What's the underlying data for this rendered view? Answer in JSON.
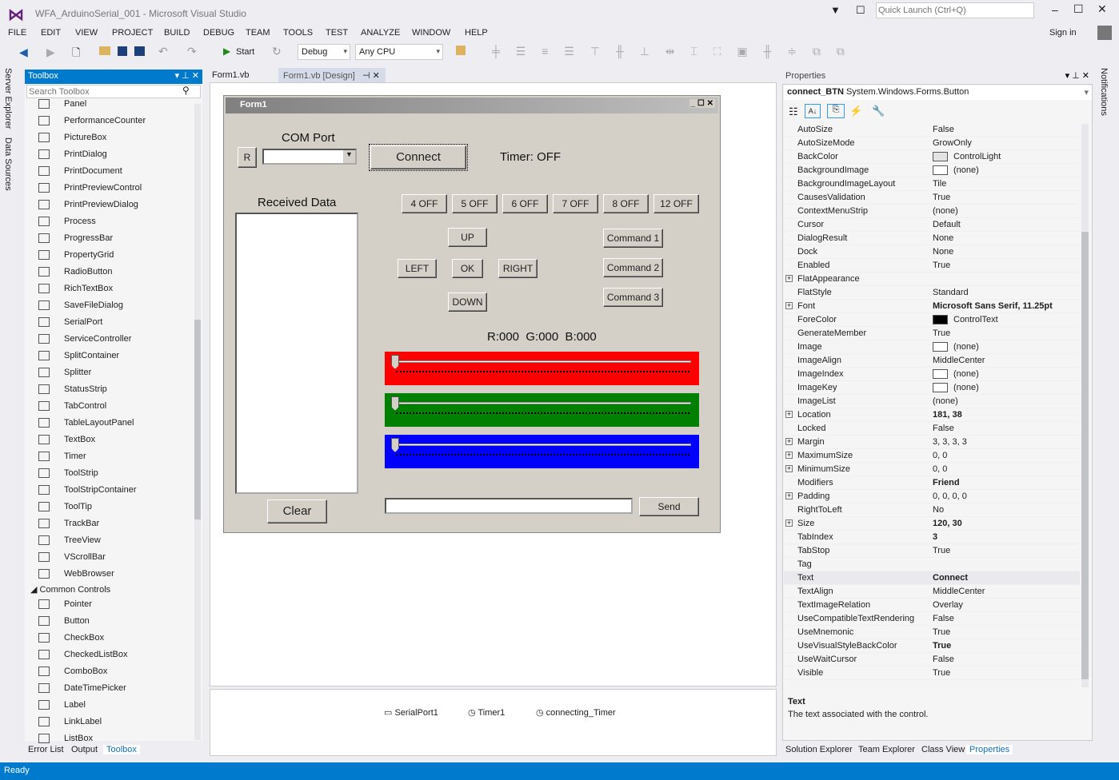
{
  "window": {
    "title": "WFA_ArduinoSerial_001 - Microsoft Visual Studio",
    "quick_launch_placeholder": "Quick Launch (Ctrl+Q)",
    "sign_in": "Sign in"
  },
  "menu": [
    "FILE",
    "EDIT",
    "VIEW",
    "PROJECT",
    "BUILD",
    "DEBUG",
    "TEAM",
    "TOOLS",
    "TEST",
    "ANALYZE",
    "WINDOW",
    "HELP"
  ],
  "toolbar": {
    "start": "Start",
    "config": "Debug",
    "platform": "Any CPU"
  },
  "left_rail": [
    "Server Explorer",
    "Data Sources"
  ],
  "right_rail": "Notifications",
  "toolbox": {
    "title": "Toolbox",
    "search_placeholder": "Search Toolbox",
    "items": [
      "Panel",
      "PerformanceCounter",
      "PictureBox",
      "PrintDialog",
      "PrintDocument",
      "PrintPreviewControl",
      "PrintPreviewDialog",
      "Process",
      "ProgressBar",
      "PropertyGrid",
      "RadioButton",
      "RichTextBox",
      "SaveFileDialog",
      "SerialPort",
      "ServiceController",
      "SplitContainer",
      "Splitter",
      "StatusStrip",
      "TabControl",
      "TableLayoutPanel",
      "TextBox",
      "Timer",
      "ToolStrip",
      "ToolStripContainer",
      "ToolTip",
      "TrackBar",
      "TreeView",
      "VScrollBar",
      "WebBrowser"
    ],
    "group": "Common Controls",
    "common": [
      "Pointer",
      "Button",
      "CheckBox",
      "CheckedListBox",
      "ComboBox",
      "DateTimePicker",
      "Label",
      "LinkLabel",
      "ListBox"
    ]
  },
  "bottom_left_tabs": [
    "Error List",
    "Output",
    "Toolbox"
  ],
  "doc_tabs": [
    "Form1.vb",
    "Form1.vb [Design]"
  ],
  "form": {
    "title": "Form1",
    "com_port_label": "COM Port",
    "r_button": "R",
    "connect": "Connect",
    "timer_status": "Timer: OFF",
    "received_label": "Received Data",
    "pin_buttons": [
      "4 OFF",
      "5 OFF",
      "6 OFF",
      "7 OFF",
      "8 OFF",
      "12 OFF"
    ],
    "up": "UP",
    "left": "LEFT",
    "ok": "OK",
    "right": "RIGHT",
    "down": "DOWN",
    "commands": [
      "Command 1",
      "Command 2",
      "Command 3"
    ],
    "rgb_readout": "R:000  G:000  B:000",
    "sliders": [
      {
        "color": "#ff0000",
        "value": 0
      },
      {
        "color": "#008000",
        "value": 0
      },
      {
        "color": "#0000ff",
        "value": 0
      }
    ],
    "clear": "Clear",
    "send": "Send",
    "send_value": ""
  },
  "component_tray": [
    "SerialPort1",
    "Timer1",
    "connecting_Timer"
  ],
  "properties": {
    "title": "Properties",
    "object_name": "connect_BTN",
    "object_type": "System.Windows.Forms.Button",
    "rows": [
      [
        "AutoSize",
        "False"
      ],
      [
        "AutoSizeMode",
        "GrowOnly"
      ],
      [
        "BackColor",
        "ControlLight",
        "#e3e3e3"
      ],
      [
        "BackgroundImage",
        "(none)",
        "#ffffff"
      ],
      [
        "BackgroundImageLayout",
        "Tile"
      ],
      [
        "CausesValidation",
        "True"
      ],
      [
        "ContextMenuStrip",
        "(none)"
      ],
      [
        "Cursor",
        "Default"
      ],
      [
        "DialogResult",
        "None"
      ],
      [
        "Dock",
        "None"
      ],
      [
        "Enabled",
        "True"
      ],
      [
        "FlatAppearance",
        "",
        "",
        1
      ],
      [
        "FlatStyle",
        "Standard"
      ],
      [
        "Font",
        "Microsoft Sans Serif, 11.25pt",
        "",
        1,
        1
      ],
      [
        "ForeColor",
        "ControlText",
        "#000000"
      ],
      [
        "GenerateMember",
        "True"
      ],
      [
        "Image",
        "(none)",
        "#ffffff"
      ],
      [
        "ImageAlign",
        "MiddleCenter"
      ],
      [
        "ImageIndex",
        "(none)",
        "#ffffff"
      ],
      [
        "ImageKey",
        "(none)",
        "#ffffff"
      ],
      [
        "ImageList",
        "(none)"
      ],
      [
        "Location",
        "181, 38",
        "",
        1,
        1
      ],
      [
        "Locked",
        "False"
      ],
      [
        "Margin",
        "3, 3, 3, 3",
        "",
        1
      ],
      [
        "MaximumSize",
        "0, 0",
        "",
        1
      ],
      [
        "MinimumSize",
        "0, 0",
        "",
        1
      ],
      [
        "Modifiers",
        "Friend",
        "",
        0,
        1
      ],
      [
        "Padding",
        "0, 0, 0, 0",
        "",
        1
      ],
      [
        "RightToLeft",
        "No"
      ],
      [
        "Size",
        "120, 30",
        "",
        1,
        1
      ],
      [
        "TabIndex",
        "3",
        "",
        0,
        1
      ],
      [
        "TabStop",
        "True"
      ],
      [
        "Tag",
        ""
      ],
      [
        "Text",
        "Connect",
        "",
        0,
        1
      ],
      [
        "TextAlign",
        "MiddleCenter"
      ],
      [
        "TextImageRelation",
        "Overlay"
      ],
      [
        "UseCompatibleTextRendering",
        "False"
      ],
      [
        "UseMnemonic",
        "True"
      ],
      [
        "UseVisualStyleBackColor",
        "True",
        "",
        0,
        1
      ],
      [
        "UseWaitCursor",
        "False"
      ],
      [
        "Visible",
        "True"
      ]
    ],
    "desc_title": "Text",
    "desc_text": "The text associated with the control."
  },
  "bottom_right_tabs": [
    "Solution Explorer",
    "Team Explorer",
    "Class View",
    "Properties"
  ],
  "status": "Ready",
  "colors": {
    "accent": "#007acc",
    "status_bar": "#007acc"
  }
}
